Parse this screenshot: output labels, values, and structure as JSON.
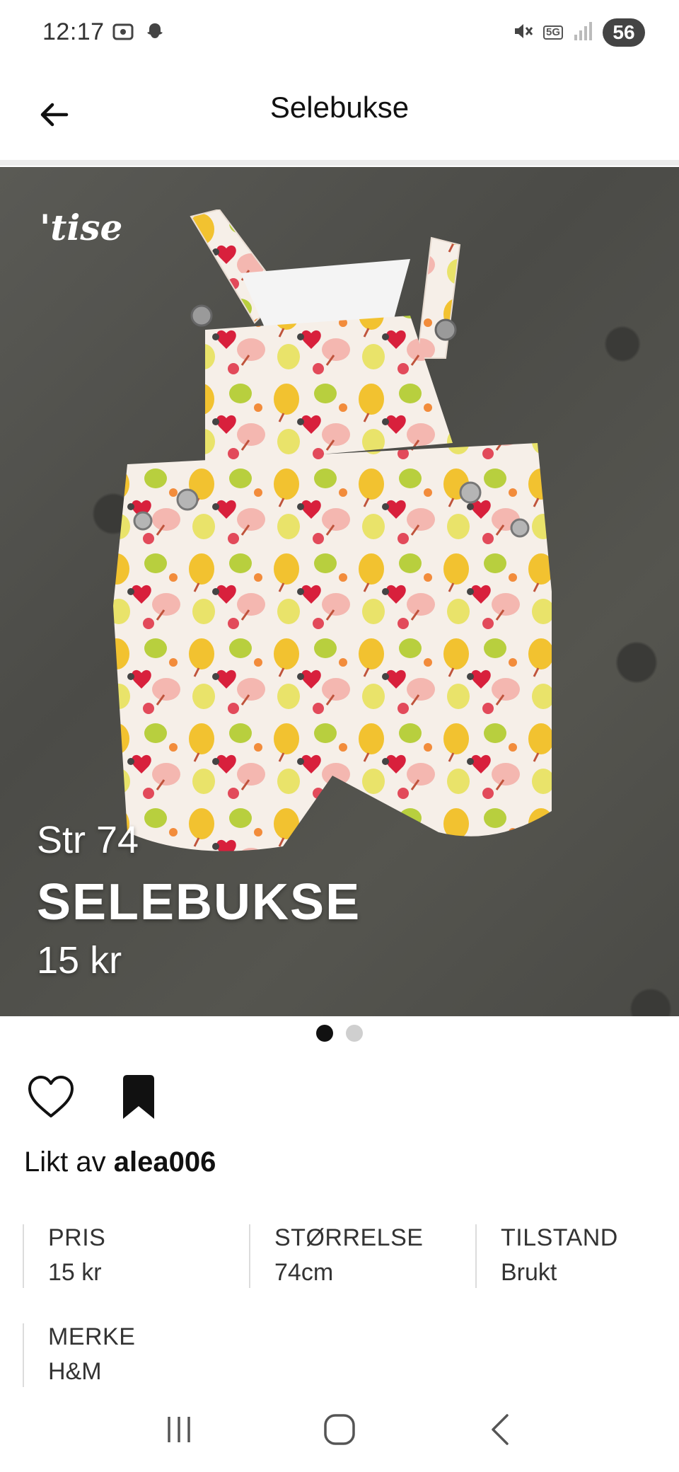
{
  "status_bar": {
    "time": "12:17",
    "network": "5G",
    "battery": "56",
    "icons": [
      "screenshot-icon",
      "snapchat-icon",
      "mute-icon",
      "network-5g-icon",
      "signal-icon",
      "battery-icon"
    ]
  },
  "app_bar": {
    "title": "Selebukse",
    "back_icon": "arrow-left-icon"
  },
  "hero": {
    "logo_text": "'tise",
    "size_text": "Str 74",
    "title_text": "SELEBUKSE",
    "price_text": "15 kr",
    "dot_count": 2,
    "active_dot": 0
  },
  "actions": {
    "like_icon": "heart-outline-icon",
    "save_icon": "bookmark-filled-icon"
  },
  "likes": {
    "prefix": "Likt av",
    "user": "alea006"
  },
  "details": [
    {
      "label": "PRIS",
      "value": "15 kr"
    },
    {
      "label": "STØRRELSE",
      "value": "74cm"
    },
    {
      "label": "TILSTAND",
      "value": "Brukt"
    },
    {
      "label": "MERKE",
      "value": "H&M"
    }
  ],
  "nav_bar": {
    "icons": [
      "recent-apps-icon",
      "home-icon",
      "back-nav-icon"
    ]
  },
  "colors": {
    "text": "#111111",
    "divider": "#dcdcdc",
    "hero_background": "#4f4f4a",
    "dot_active": "#111111",
    "dot_inactive": "#cfcfcf"
  }
}
